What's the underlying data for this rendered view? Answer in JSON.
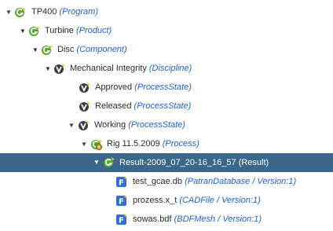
{
  "tree": {
    "nodes": [
      {
        "name": "TP400",
        "type": "(Program)",
        "icon": "green-g-icon",
        "expanded": true
      },
      {
        "name": "Turbine",
        "type": "(Product)",
        "icon": "green-g-icon",
        "expanded": true
      },
      {
        "name": "Disc",
        "type": "(Component)",
        "icon": "green-g-icon",
        "expanded": true
      },
      {
        "name": "Mechanical Integrity",
        "type": "(Discipline)",
        "icon": "dark-v-icon",
        "expanded": true
      },
      {
        "name": "Approved",
        "type": "(ProcessState)",
        "icon": "dark-v-icon"
      },
      {
        "name": "Released",
        "type": "(ProcessState)",
        "icon": "dark-v-icon"
      },
      {
        "name": "Working",
        "type": "(ProcessState)",
        "icon": "dark-v-icon",
        "expanded": true
      },
      {
        "name": "Rig 11.5.2009",
        "type": "(Process)",
        "icon": "gear-process-icon",
        "expanded": true
      },
      {
        "name": "Result-2009_07_20-16_16_57",
        "type": "(Result)",
        "icon": "green-g-icon",
        "expanded": true,
        "selected": true
      },
      {
        "name": "test_gcae.db",
        "type": "(PatranDatabase / Version:1)",
        "icon": "blue-f-file-icon"
      },
      {
        "name": "prozess.x_t",
        "type": "(CADFile / Version:1)",
        "icon": "blue-f-file-icon"
      },
      {
        "name": "sowas.bdf",
        "type": "(BDFMesh / Version:1)",
        "icon": "blue-f-file-icon"
      }
    ]
  },
  "colors": {
    "selection": "#3a6789",
    "type_text": "#1f5fd0",
    "green_icon": "#4ea82a",
    "dark_icon": "#3c3c4a",
    "file_icon": "#2f6fd6"
  }
}
